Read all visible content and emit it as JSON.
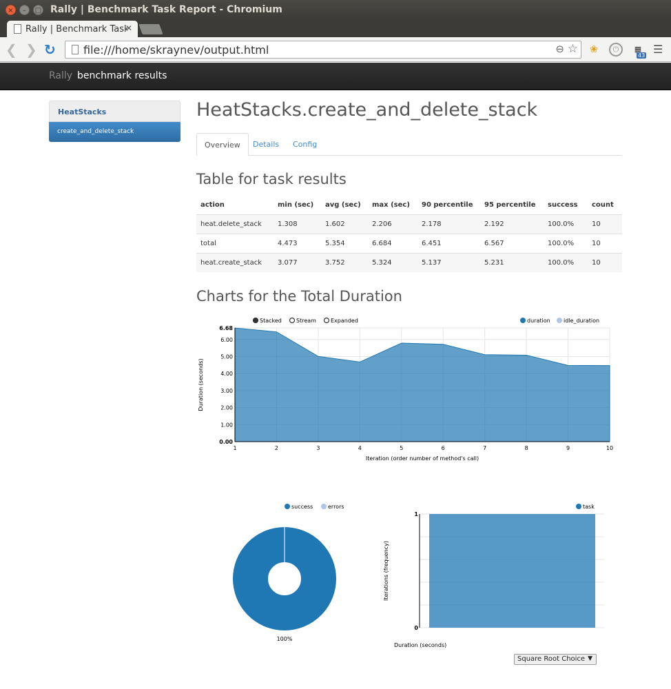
{
  "window": {
    "title": "Rally | Benchmark Task Report - Chromium",
    "tab_title": "Rally | Benchmark Task Report",
    "url": "file:///home/skraynev/output.html",
    "extension_badge": "43"
  },
  "navbar": {
    "brand": "Rally",
    "text": "benchmark results"
  },
  "sidebar": {
    "group": "HeatStacks",
    "item": "create_and_delete_stack"
  },
  "main": {
    "title": "HeatStacks.create_and_delete_stack",
    "tabs": [
      "Overview",
      "Details",
      "Config"
    ]
  },
  "table": {
    "title": "Table for task results",
    "columns": [
      "action",
      "min (sec)",
      "avg (sec)",
      "max (sec)",
      "90 percentile",
      "95 percentile",
      "success",
      "count"
    ],
    "rows": [
      [
        "heat.delete_stack",
        "1.308",
        "1.602",
        "2.206",
        "2.178",
        "2.192",
        "100.0%",
        "10"
      ],
      [
        "total",
        "4.473",
        "5.354",
        "6.684",
        "6.451",
        "6.567",
        "100.0%",
        "10"
      ],
      [
        "heat.create_stack",
        "3.077",
        "3.752",
        "5.324",
        "5.137",
        "5.231",
        "100.0%",
        "10"
      ]
    ]
  },
  "charts_title": "Charts for the Total Duration",
  "chart_data": [
    {
      "type": "area",
      "title": "",
      "controls": [
        "Stacked",
        "Stream",
        "Expanded"
      ],
      "selected_control": "Stacked",
      "legend_placement": "top-right",
      "xlabel": "Iteration (order number of method's call)",
      "ylabel": "Duration (seconds)",
      "x": [
        1,
        2,
        3,
        4,
        5,
        6,
        7,
        8,
        9,
        10
      ],
      "series": [
        {
          "name": "duration",
          "color": "#1f77b4",
          "values": [
            6.68,
            6.45,
            5.01,
            4.68,
            5.79,
            5.72,
            5.11,
            5.08,
            4.48,
            4.47
          ]
        },
        {
          "name": "idle_duration",
          "color": "#aec7e8",
          "values": [
            0,
            0,
            0,
            0,
            0,
            0,
            0,
            0,
            0,
            0
          ]
        }
      ],
      "yticks": [
        "0.00",
        "1.00",
        "2.00",
        "3.00",
        "4.00",
        "5.00",
        "6.00",
        "6.68"
      ],
      "ylim": [
        0,
        6.68
      ],
      "xlim": [
        1,
        10
      ],
      "grid": true
    },
    {
      "type": "pie",
      "title": "",
      "donut": true,
      "legend_placement": "top",
      "slices": [
        {
          "name": "success",
          "color": "#1f77b4",
          "value": 100
        },
        {
          "name": "errors",
          "color": "#aec7e8",
          "value": 0
        }
      ],
      "label": "100%"
    },
    {
      "type": "bar",
      "title": "",
      "legend_placement": "top-right",
      "xlabel": "Duration (seconds)",
      "ylabel": "Iterations (frequency)",
      "series": [
        {
          "name": "task",
          "color": "#1f77b4",
          "values": [
            1
          ]
        }
      ],
      "yticks": [
        "0",
        "1"
      ],
      "ylim": [
        0,
        1
      ],
      "method": "Square Root Choice"
    }
  ]
}
